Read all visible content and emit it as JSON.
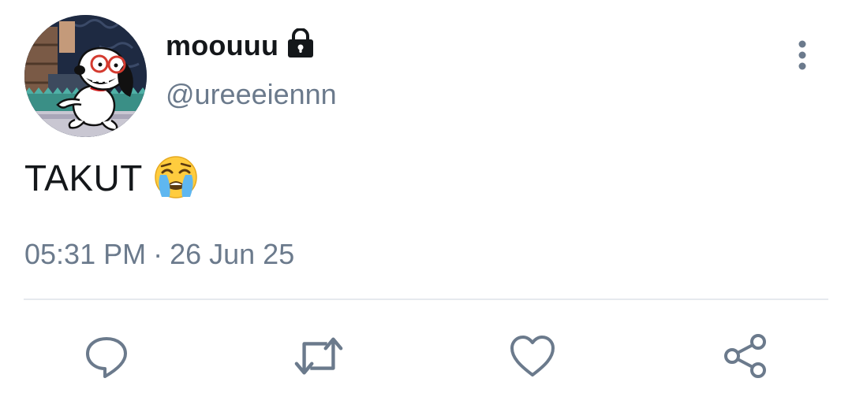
{
  "user": {
    "display_name": "moouuu",
    "handle": "@ureeeiennn",
    "protected_icon": "lock-icon",
    "avatar": "snoopy-cartoon-avatar"
  },
  "tweet": {
    "text": "TAKUT",
    "emoji": "loudly-crying-face-emoji",
    "time": "05:31 PM",
    "separator": "·",
    "date": "26 Jun 25"
  },
  "actions": [
    {
      "name": "reply",
      "icon": "reply-icon"
    },
    {
      "name": "retweet",
      "icon": "retweet-icon"
    },
    {
      "name": "like",
      "icon": "heart-icon"
    },
    {
      "name": "share",
      "icon": "share-icon"
    }
  ],
  "colors": {
    "text_primary": "#14171a",
    "text_secondary": "#6b7a8c",
    "icon": "#6b7a8c",
    "divider": "#e6e9ee",
    "background": "#ffffff"
  }
}
